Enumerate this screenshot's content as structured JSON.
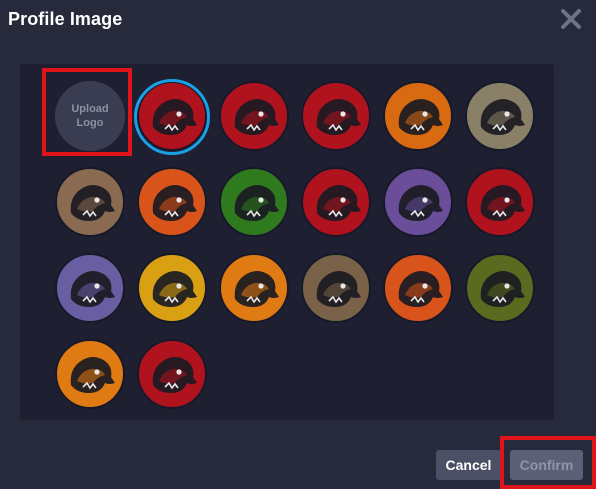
{
  "dialog": {
    "title": "Profile Image",
    "close_label": "close",
    "upload_label": "Upload Logo",
    "cancel_label": "Cancel",
    "confirm_label": "Confirm"
  },
  "logos": [
    {
      "name": "red-dragon-icon",
      "bg": "#b0121e",
      "selected": true
    },
    {
      "name": "red-ram-icon",
      "bg": "#b0121e"
    },
    {
      "name": "red-raptor-icon",
      "bg": "#b0121e"
    },
    {
      "name": "fox-icon",
      "bg": "#d86a12"
    },
    {
      "name": "triceratops-icon",
      "bg": "#8a8068"
    },
    {
      "name": "t-rex-icon",
      "bg": "#8a6a50"
    },
    {
      "name": "bear-icon",
      "bg": "#d8541a"
    },
    {
      "name": "snake-icon",
      "bg": "#2f7a1e"
    },
    {
      "name": "red-horse-icon",
      "bg": "#b0121e"
    },
    {
      "name": "octopus-icon",
      "bg": "#6a4e9a"
    },
    {
      "name": "bull-icon",
      "bg": "#b0121e"
    },
    {
      "name": "rhino-icon",
      "bg": "#6a5ea2"
    },
    {
      "name": "wolf-icon",
      "bg": "#d8a012"
    },
    {
      "name": "eagle-icon",
      "bg": "#e07a12"
    },
    {
      "name": "cobra-icon",
      "bg": "#7a6248"
    },
    {
      "name": "hawk-icon",
      "bg": "#d8541a"
    },
    {
      "name": "crocodile-icon",
      "bg": "#5a6a1e"
    },
    {
      "name": "panther-icon",
      "bg": "#e07a12"
    },
    {
      "name": "boar-icon",
      "bg": "#b0121e"
    }
  ],
  "colors": {
    "background": "#272a3a",
    "panel": "#1e2031",
    "selected_ring": "#1aa0e6",
    "highlight": "#e0151c",
    "head_dark": "#1a1a22",
    "head_light": "#e8e8ea"
  }
}
